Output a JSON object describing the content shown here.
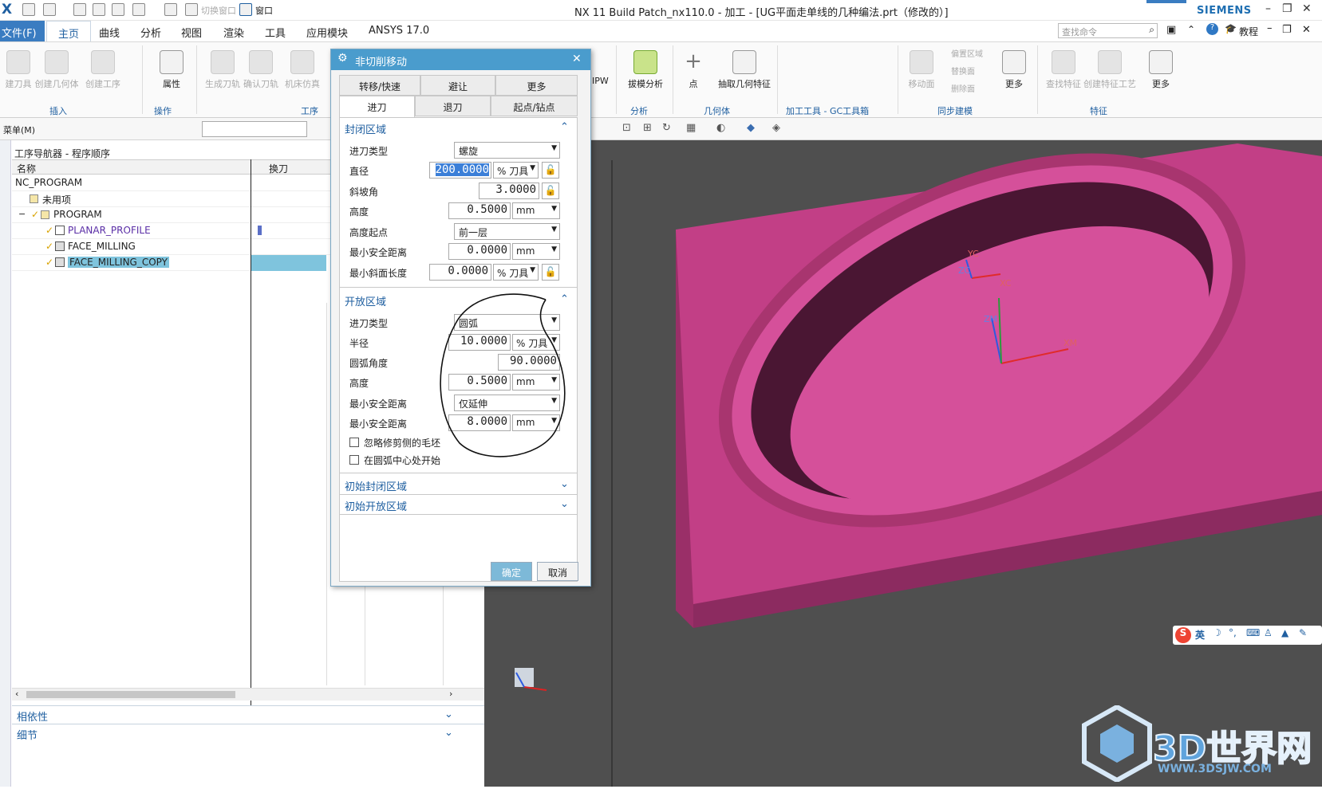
{
  "window": {
    "title": "NX 11  Build Patch_nx110.0 - 加工 - [UG平面走单线的几种编法.prt（修改的）]",
    "brand": "SIEMENS",
    "app_logo": "X",
    "window_menu_label": "窗口",
    "switch_window_label": "切换窗口"
  },
  "menubar": {
    "file": "文件(F)",
    "tabs": [
      "主页",
      "曲线",
      "分析",
      "视图",
      "渲染",
      "工具",
      "应用模块",
      "ANSYS 17.0"
    ],
    "search_placeholder": "查找命令",
    "tutorial": "教程"
  },
  "ribbon": {
    "buttons": [
      "建刀具",
      "创建几何体",
      "创建工序",
      "属性",
      "生成刀轨",
      "确认刀轨",
      "机床仿真",
      "IPW",
      "拔模分析",
      "点",
      "抽取几何特征",
      "移动面",
      "偏置区域",
      "替换面",
      "删除面",
      "更多",
      "查找特征",
      "创建特征工艺",
      "更多"
    ],
    "groups": [
      "插入",
      "操作",
      "工序",
      "分析",
      "几何体",
      "加工工具 - GC工具箱",
      "同步建模",
      "特征"
    ]
  },
  "toolbar2": {
    "menu_label": "菜单(M)"
  },
  "navigator": {
    "title": "工序导航器 - 程序顺序",
    "col_name": "名称",
    "col_tool_change": "换刀",
    "rows": [
      {
        "name": "NC_PROGRAM"
      },
      {
        "name": "未用项"
      },
      {
        "name": "PROGRAM"
      },
      {
        "name": "PLANAR_PROFILE"
      },
      {
        "name": "FACE_MILLING"
      },
      {
        "name": "FACE_MILLING_COPY"
      }
    ],
    "selected_row": "FACE_MILLING_COPY",
    "panels": [
      "相依性",
      "细节"
    ]
  },
  "dialog": {
    "title": "非切削移动",
    "tabs_row1": [
      "转移/快速",
      "避让",
      "更多"
    ],
    "tabs_row2": [
      "进刀",
      "退刀",
      "起点/钻点"
    ],
    "active_tab": "进刀",
    "closed_area": {
      "heading": "封闭区域",
      "entry_type_label": "进刀类型",
      "entry_type": "螺旋",
      "diameter_label": "直径",
      "diameter": "200.0000",
      "diameter_unit": "% 刀具",
      "ramp_angle_label": "斜坡角",
      "ramp_angle": "3.0000",
      "height_label": "高度",
      "height": "0.5000",
      "height_unit": "mm",
      "height_from_label": "高度起点",
      "height_from": "前一层",
      "min_safe_label": "最小安全距离",
      "min_safe": "0.0000",
      "min_safe_unit": "mm",
      "min_ramp_label": "最小斜面长度",
      "min_ramp": "0.0000",
      "min_ramp_unit": "% 刀具"
    },
    "open_area": {
      "heading": "开放区域",
      "entry_type_label": "进刀类型",
      "entry_type": "圆弧",
      "radius_label": "半径",
      "radius": "10.0000",
      "radius_unit": "% 刀具",
      "arc_angle_label": "圆弧角度",
      "arc_angle": "90.0000",
      "height_label": "高度",
      "height": "0.5000",
      "height_unit": "mm",
      "min_safe_label": "最小安全距离",
      "min_safe_mode": "仅延伸",
      "min_safe2_label": "最小安全距离",
      "min_safe2": "8.0000",
      "min_safe2_unit": "mm",
      "chk_ignore_label": "忽略修剪侧的毛坯",
      "chk_arc_center_label": "在圆弧中心处开始"
    },
    "initial_closed": "初始封闭区域",
    "initial_open": "初始开放区域",
    "ok": "确定",
    "cancel": "取消"
  },
  "viewport": {
    "part_color": "#d9519a",
    "background": "#4f4f4f",
    "axes": [
      "YC",
      "ZC",
      "XC",
      "ZM",
      "XM"
    ]
  },
  "ime": {
    "lang": "英"
  },
  "watermark": {
    "text": "3D世界网",
    "url": "WWW.3DSJW.COM"
  }
}
